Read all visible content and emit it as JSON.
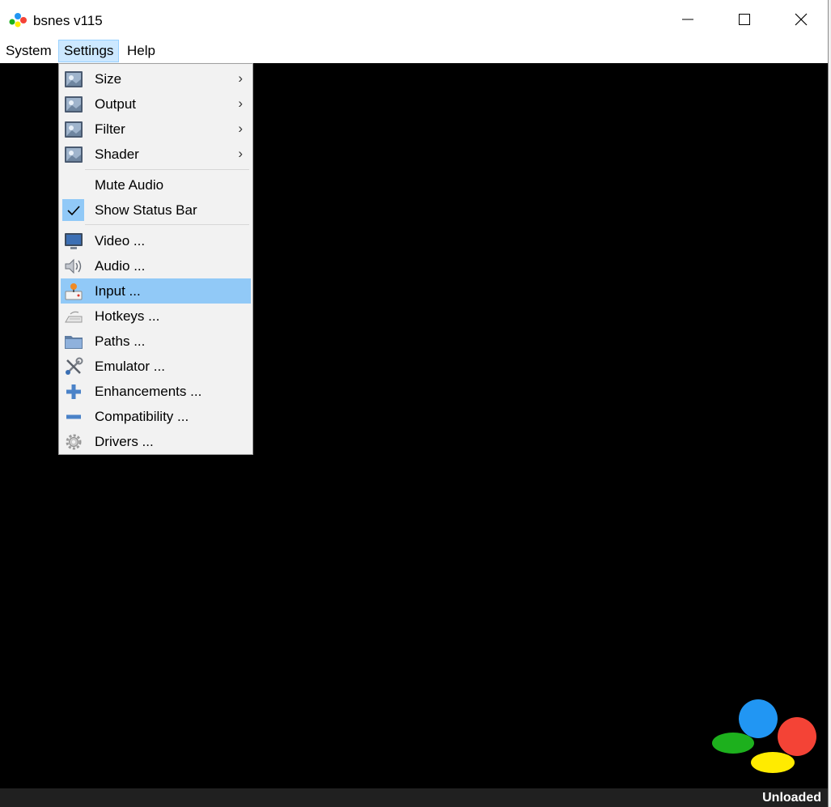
{
  "window": {
    "title": "bsnes v115"
  },
  "menubar": {
    "system": "System",
    "settings": "Settings",
    "help": "Help"
  },
  "settings_menu": {
    "size": "Size",
    "output": "Output",
    "filter": "Filter",
    "shader": "Shader",
    "mute_audio": "Mute Audio",
    "show_status_bar": "Show Status Bar",
    "video": "Video ...",
    "audio": "Audio ...",
    "input": "Input ...",
    "hotkeys": "Hotkeys ...",
    "paths": "Paths ...",
    "emulator": "Emulator ...",
    "enhancements": "Enhancements ...",
    "compatibility": "Compatibility ...",
    "drivers": "Drivers ..."
  },
  "statusbar": {
    "text": "Unloaded"
  },
  "colors": {
    "highlight": "#91c9f7",
    "logo_blue": "#2196f3",
    "logo_red": "#f44336",
    "logo_green": "#1db01d",
    "logo_yellow": "#ffeb00"
  }
}
